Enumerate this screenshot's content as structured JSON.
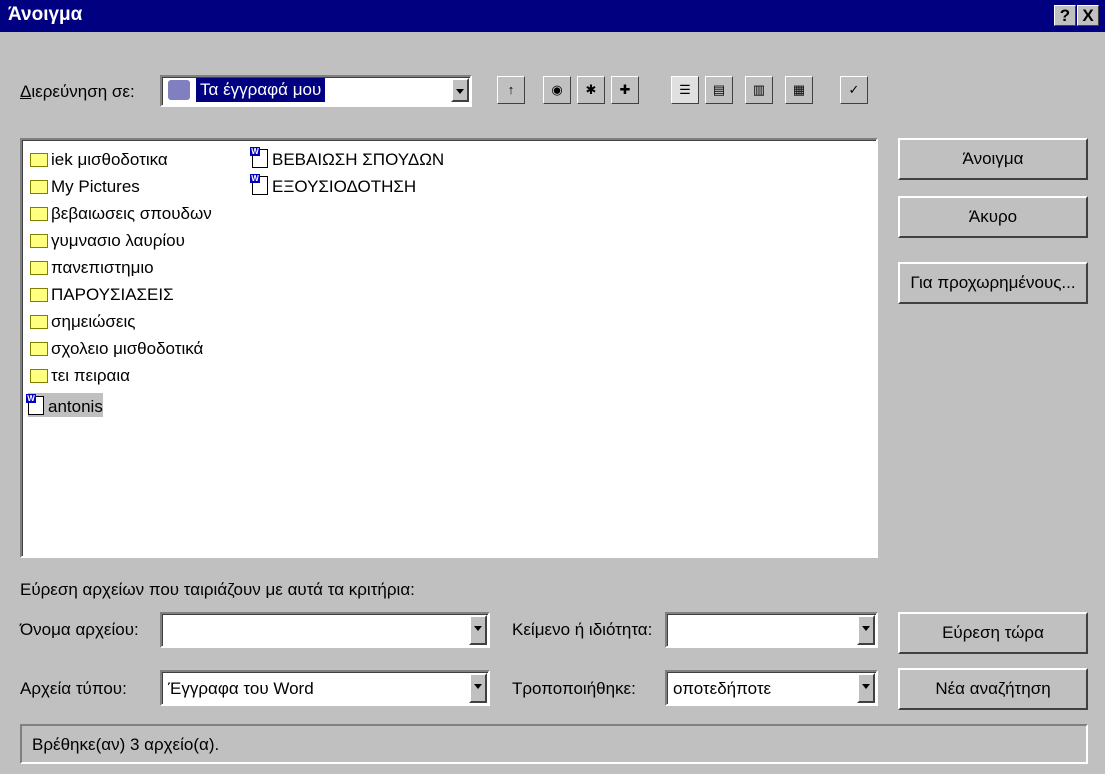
{
  "window": {
    "title": "Άνοιγμα",
    "help_label": "?",
    "close_label": "X"
  },
  "look_in": {
    "label_underline": "Δ",
    "label_rest": "ιερεύνηση σε:",
    "value": "Τα έγγραφά μου"
  },
  "files": {
    "col1": [
      {
        "type": "folder",
        "name": "iek μισθοδοτικα"
      },
      {
        "type": "folder",
        "name": "My Pictures"
      },
      {
        "type": "folder",
        "name": "βεβαιωσεις σπουδων"
      },
      {
        "type": "folder",
        "name": "γυμνασιο λαυρίου"
      },
      {
        "type": "folder",
        "name": "πανεπιστημιο"
      },
      {
        "type": "folder",
        "name": "ΠΑΡΟΥΣΙΑΣΕΙΣ"
      },
      {
        "type": "folder",
        "name": "σημειώσεις"
      },
      {
        "type": "folder",
        "name": "σχολειο μισθοδοτικά"
      },
      {
        "type": "folder",
        "name": "τει πειραια"
      },
      {
        "type": "doc",
        "name": "antonis"
      }
    ],
    "col2": [
      {
        "type": "doc",
        "name": "ΒΕΒΑΙΩΣΗ ΣΠΟΥΔΩΝ"
      },
      {
        "type": "doc",
        "name": "ΕΞΟΥΣΙΟΔΟΤΗΣΗ"
      }
    ]
  },
  "buttons": {
    "open": "Άνοιγμα",
    "cancel": "Άκυρο",
    "advanced": "Για προχωρημένους...",
    "find_now": "Εύρεση τώρα",
    "new_search": "Νέα αναζήτηση"
  },
  "search": {
    "heading": "Εύρεση αρχείων που ταιριάζουν με αυτά τα κριτήρια:",
    "filename_label": "Όνομα αρχείου:",
    "filename_value": "",
    "text_label": "Κείμενο ή ιδιότητα:",
    "text_value": "",
    "filetype_label": "Αρχεία τύπου:",
    "filetype_value": "Έγγραφα του Word",
    "modified_label": "Τροποποιήθηκε:",
    "modified_value": "οποτεδήποτε"
  },
  "status": "Βρέθηκε(αν) 3 αρχείο(α)."
}
